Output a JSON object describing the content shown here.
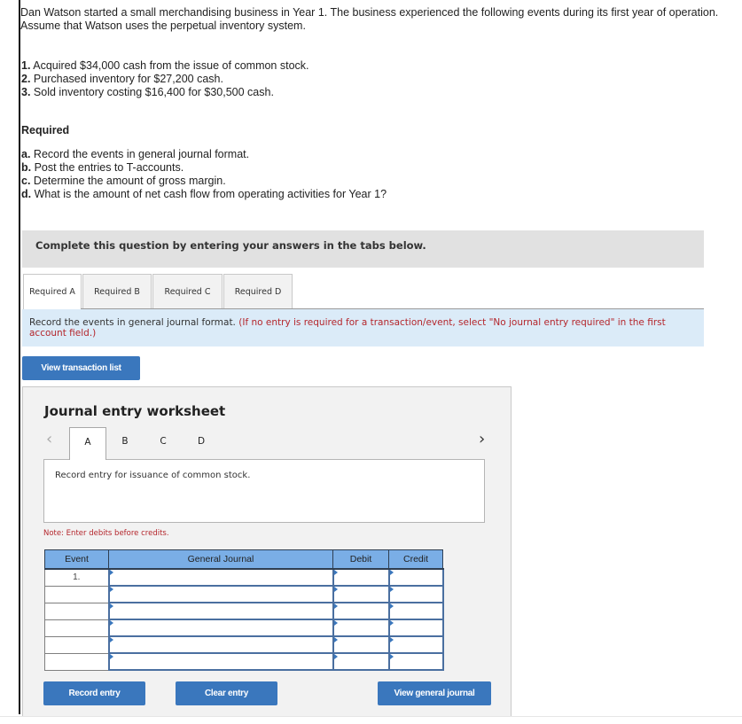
{
  "problem": {
    "intro": "Dan Watson started a small merchandising business in Year 1. The business experienced the following events during its first year of operation. Assume that Watson uses the perpetual inventory system.",
    "events": [
      {
        "num": "1.",
        "text": "Acquired $34,000 cash from the issue of common stock."
      },
      {
        "num": "2.",
        "text": "Purchased inventory for $27,200 cash."
      },
      {
        "num": "3.",
        "text": "Sold inventory costing $16,400 for $30,500 cash."
      }
    ],
    "required_title": "Required",
    "required_items": [
      {
        "letter": "a.",
        "text": "Record the events in general journal format."
      },
      {
        "letter": "b.",
        "text": "Post the entries to T-accounts."
      },
      {
        "letter": "c.",
        "text": "Determine the amount of gross margin."
      },
      {
        "letter": "d.",
        "text": "What is the amount of net cash flow from operating activities for Year 1?"
      }
    ]
  },
  "instruction_banner": "Complete this question by entering your answers in the tabs below.",
  "tabs": [
    {
      "label": "Required A",
      "active": true
    },
    {
      "label": "Required B",
      "active": false
    },
    {
      "label": "Required C",
      "active": false
    },
    {
      "label": "Required D",
      "active": false
    }
  ],
  "directions": {
    "main": "Record the events in general journal format.",
    "note": "(If no entry is required for a transaction/event, select \"No journal entry required\" in the first account field.)"
  },
  "buttons": {
    "view_transaction_list": "View transaction list",
    "record_entry": "Record entry",
    "clear_entry": "Clear entry",
    "view_general_journal": "View general journal"
  },
  "worksheet": {
    "title": "Journal entry worksheet",
    "prev_icon": "‹",
    "next_icon": "›",
    "tabs": [
      {
        "label": "A",
        "active": true
      },
      {
        "label": "B",
        "active": false
      },
      {
        "label": "C",
        "active": false
      },
      {
        "label": "D",
        "active": false
      }
    ],
    "description": "Record entry for issuance of common stock.",
    "note": "Note: Enter debits before credits.",
    "table": {
      "headers": [
        "Event",
        "General Journal",
        "Debit",
        "Credit"
      ],
      "rows": [
        {
          "event": "1.",
          "account": "",
          "debit": "",
          "credit": ""
        },
        {
          "event": "",
          "account": "",
          "debit": "",
          "credit": ""
        },
        {
          "event": "",
          "account": "",
          "debit": "",
          "credit": ""
        },
        {
          "event": "",
          "account": "",
          "debit": "",
          "credit": ""
        },
        {
          "event": "",
          "account": "",
          "debit": "",
          "credit": ""
        },
        {
          "event": "",
          "account": "",
          "debit": "",
          "credit": ""
        }
      ]
    }
  },
  "colors": {
    "button_blue": "#3a77bd",
    "table_header_blue": "#7aaee6",
    "note_red": "#b4262c",
    "directions_bg": "#dbebf8",
    "banner_gray": "#e1e1e1"
  }
}
